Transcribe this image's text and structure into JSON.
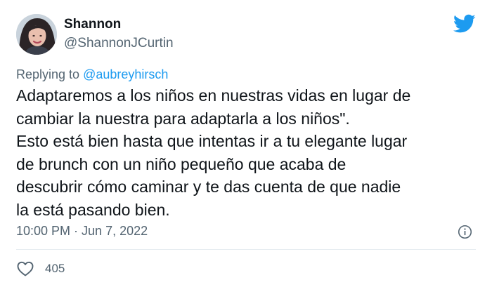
{
  "author": {
    "name": "Shannon",
    "handle": "@ShannonJCurtin",
    "avatar_icon": "profile-photo-avatar"
  },
  "brand": {
    "icon": "twitter-bird-icon",
    "color": "#1d9bf0"
  },
  "reply": {
    "prefix": "Replying to ",
    "to": "@aubreyhirsch"
  },
  "body": {
    "lines": [
      "Adaptaremos a los niños en nuestras vidas en lugar de",
      "cambiar la nuestra para adaptarla a los niños\".",
      "Esto está bien hasta que intentas ir a tu elegante lugar",
      "de brunch con un niño pequeño que acaba de",
      "descubrir cómo caminar y te das cuenta de que nadie",
      "la está pasando bien."
    ]
  },
  "meta": {
    "time": "10:00 PM",
    "separator": " · ",
    "date": "Jun 7, 2022",
    "info_icon": "info-icon"
  },
  "actions": {
    "like_icon": "heart-icon",
    "like_count": "405"
  },
  "colors": {
    "text": "#0f1419",
    "secondary": "#536471",
    "mention": "#1d9bf0",
    "divider": "#e6ecf0"
  }
}
